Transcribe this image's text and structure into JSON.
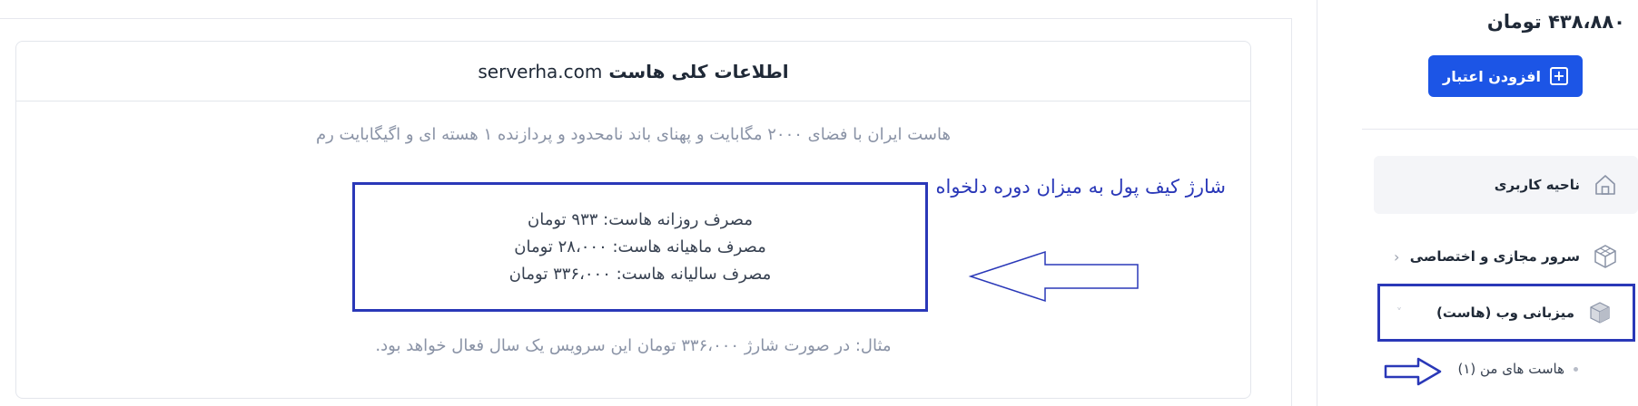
{
  "card": {
    "title": "اطلاعات کلی هاست",
    "domain": "serverha.com",
    "description": "هاست ایران با فضای ۲۰۰۰ مگابایت و پهنای باند نامحدود و پردازنده ۱ هسته ای و اگیگابایت رم",
    "usage": {
      "daily": "مصرف روزانه هاست: ۹۳۳ تومان",
      "monthly": "مصرف ماهیانه هاست: ۲۸،۰۰۰ تومان",
      "yearly": "مصرف سالیانه هاست: ۳۳۶،۰۰۰ تومان"
    },
    "example": "مثال: در صورت شارژ ۳۳۶،۰۰۰ تومان این سرویس یک سال فعال خواهد بود."
  },
  "annotation": {
    "text": "شارژ کیف پول به میزان دوره دلخواه",
    "color": "#2a38b8"
  },
  "sidebar": {
    "balance": "۴۳۸،۸۸۰ تومان",
    "add_credit_label": "افزودن اعتبار",
    "items": [
      {
        "label": "ناحیه کاربری",
        "icon": "home-icon"
      },
      {
        "label": "سرور مجازی و اختصاصی",
        "icon": "cube-icon"
      },
      {
        "label": "میزبانی وب (هاست)",
        "icon": "box-icon"
      }
    ],
    "sub_items": [
      {
        "label": "هاست های من (۱)"
      }
    ]
  },
  "colors": {
    "primary_button": "#1c55e6",
    "highlight_border": "#2a38b8",
    "muted_text": "#8a93a6"
  }
}
